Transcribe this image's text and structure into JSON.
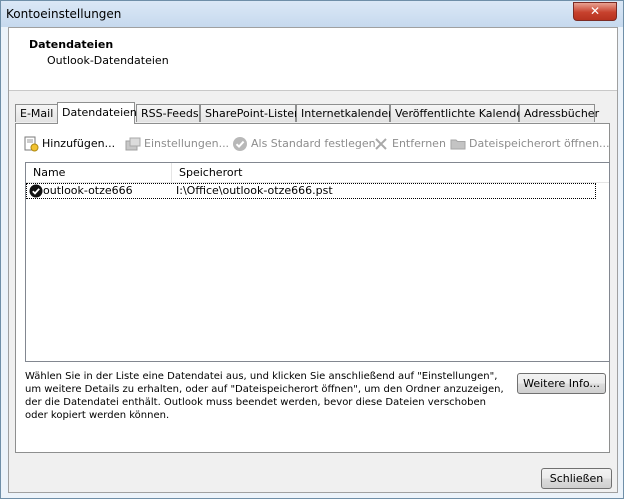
{
  "window": {
    "title": "Kontoeinstellungen",
    "close_label": "✕"
  },
  "header": {
    "title": "Datendateien",
    "subtitle": "Outlook-Datendateien"
  },
  "tabs": [
    {
      "label": "E-Mail"
    },
    {
      "label": "Datendateien",
      "active": true
    },
    {
      "label": "RSS-Feeds"
    },
    {
      "label": "SharePoint-Listen"
    },
    {
      "label": "Internetkalender"
    },
    {
      "label": "Veröffentlichte Kalender"
    },
    {
      "label": "Adressbücher"
    }
  ],
  "toolbar": {
    "add": {
      "label": "Hinzufügen...",
      "icon": "add-file-icon",
      "enabled": true
    },
    "settings": {
      "label": "Einstellungen...",
      "icon": "settings-icon",
      "enabled": false
    },
    "default": {
      "label": "Als Standard festlegen",
      "icon": "check-circle-icon",
      "enabled": false
    },
    "remove": {
      "label": "Entfernen",
      "icon": "x-icon",
      "enabled": false
    },
    "open_location": {
      "label": "Dateispeicherort öffnen...",
      "icon": "folder-icon",
      "enabled": false
    }
  },
  "list": {
    "columns": [
      "Name",
      "Speicherort"
    ],
    "rows": [
      {
        "name": "outlook-otze666",
        "location": "I:\\Office\\outlook-otze666.pst",
        "default": true
      }
    ]
  },
  "info_text": "Wählen Sie in der Liste eine Datendatei aus, und klicken Sie anschließend auf \"Einstellungen\", um weitere Details zu erhalten, oder auf \"Dateispeicherort öffnen\", um den Ordner anzuzeigen, der die Datendatei enthält. Outlook muss beendet werden, bevor diese Dateien verschoben oder kopiert werden können.",
  "more_info_button": "Weitere Info...",
  "close_button": "Schließen"
}
